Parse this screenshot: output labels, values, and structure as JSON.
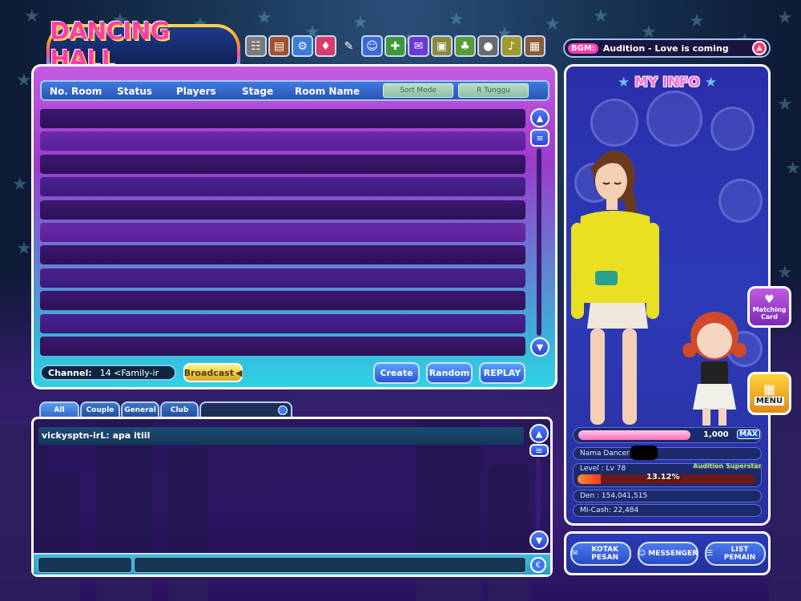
{
  "logo": {
    "text": "DANCING HALL"
  },
  "toolbar": {
    "icons": [
      {
        "name": "family-icon",
        "color": "#7a7a7a",
        "glyph": "☷"
      },
      {
        "name": "book-icon",
        "color": "#a0522d",
        "glyph": "▤"
      },
      {
        "name": "gear-icon",
        "color": "#3a7cd8",
        "glyph": "⚙"
      },
      {
        "name": "shop-icon",
        "color": "#d83a6a",
        "glyph": "♦"
      },
      {
        "name": "wand-icon",
        "color": "transparent",
        "glyph": "✎"
      },
      {
        "name": "face-icon",
        "color": "#3a6ad8",
        "glyph": "☺"
      },
      {
        "name": "puzzle-icon",
        "color": "#3a9a3a",
        "glyph": "✚"
      },
      {
        "name": "gift-icon",
        "color": "#6a3ad8",
        "glyph": "✉"
      },
      {
        "name": "photo-icon",
        "color": "#8a8a3a",
        "glyph": "▣"
      },
      {
        "name": "cards-icon",
        "color": "#5a9a3a",
        "glyph": "♣"
      },
      {
        "name": "record-icon",
        "color": "#6a6a6a",
        "glyph": "●"
      },
      {
        "name": "note-icon",
        "color": "#a09a2a",
        "glyph": "♪"
      },
      {
        "name": "folder-icon",
        "color": "#8a5a3a",
        "glyph": "▦"
      }
    ]
  },
  "bgm": {
    "label": "BGM:",
    "song": "Audition - Love is coming"
  },
  "room_list": {
    "headers": {
      "no_room": "No. Room",
      "status": "Status",
      "players": "Players",
      "stage": "Stage",
      "room_name": "Room Name"
    },
    "sort_mode": "Sort Mode",
    "r_tunggu": "R Tunggu",
    "row_count": 11
  },
  "channel": {
    "label": "Channel:",
    "value": "14 <Family-ir"
  },
  "actions": {
    "broadcast": "Broadcast",
    "create": "Create",
    "random": "Random",
    "replay": "REPLAY"
  },
  "chat": {
    "tabs": [
      "All",
      "Couple",
      "General",
      "Club"
    ],
    "messages": [
      {
        "text": "vickysptn-irL: apa itiil"
      }
    ]
  },
  "my_info": {
    "title": "MY INFO",
    "count": "1,000",
    "max_label": "MAX",
    "nama": "Nama  Dancer",
    "level": "Level : Lv 78",
    "badge": "Audition Superstar",
    "exp_percent": "13.12%",
    "exp_fraction": 0.1312,
    "den": "Den : 154,041,515",
    "mcash": "MI-Cash: 22,484"
  },
  "side": {
    "matching": "Matching Card",
    "menu": "MENU"
  },
  "bottom": {
    "kotak": "KOTAK PESAN",
    "messenger": "MESSENGER",
    "list": "LIST PEMAIN"
  }
}
